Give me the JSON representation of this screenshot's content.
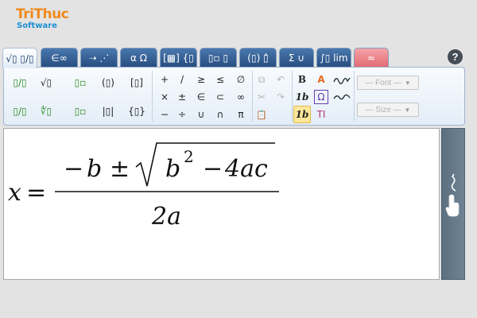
{
  "logo": {
    "line1": "TriThuc",
    "line2": "Software"
  },
  "tabs": [
    {
      "label": "√▯ ▯/▯",
      "icon": "fractions-radicals-tab"
    },
    {
      "label": "∈∞",
      "icon": "symbols-tab"
    },
    {
      "label": "➝ ⋰",
      "icon": "arrows-dots-tab"
    },
    {
      "label": "α Ω",
      "icon": "greek-tab"
    },
    {
      "label": "[▦] {▯",
      "icon": "matrix-tab"
    },
    {
      "label": "▯▫ ▯",
      "icon": "scripts-tab"
    },
    {
      "label": "(▯) ▯̂",
      "icon": "brackets-accents-tab"
    },
    {
      "label": "Σ ∪",
      "icon": "sums-tab"
    },
    {
      "label": "∫▯ lim",
      "icon": "integrals-tab"
    },
    {
      "label": "≈",
      "icon": "special-tab"
    }
  ],
  "help_label": "?",
  "toolbar": {
    "row1": {
      "fraction": "▯/▯",
      "sqrt": "√▯",
      "superscript": "▯▫",
      "paren": "(▯)",
      "bracket": "[▯]",
      "plus": "+",
      "slash": "/",
      "geq": "≥",
      "leq": "≤",
      "emptyset": "∅"
    },
    "row2": {
      "times": "×",
      "plusminus": "±",
      "in": "∈",
      "subset": "⊂",
      "infinity": "∞"
    },
    "row3": {
      "slash_fraction": "▯/▯",
      "nth_root": "∜▯",
      "subscript": "▯▫",
      "abs": "|▯|",
      "brace": "{▯}",
      "minus": "−",
      "divide": "÷",
      "union": "∪",
      "intersection": "∩",
      "pi": "π"
    },
    "edit": {
      "copy": "⧉",
      "cut": "✂",
      "paste": "📋",
      "undo": "↶",
      "redo": "↷"
    },
    "format": {
      "bold": "B",
      "italic": "1b",
      "italic_selected": "1b",
      "text_color": "A",
      "special_char": "Ω",
      "text_mode": "TI"
    },
    "font_combo": "— Font —",
    "size_combo": "— Size —"
  },
  "equation": {
    "x": "x",
    "eq": "=",
    "minus": "−",
    "b": "b",
    "pm": "±",
    "b2": "b",
    "exp": "2",
    "minus2": "−",
    "four_ac": "4ac",
    "denom": "2a"
  },
  "colors": {
    "accent": "#f08a1c",
    "tab_blue": "#2f5d94",
    "brand_blue": "#1b8fd1"
  }
}
